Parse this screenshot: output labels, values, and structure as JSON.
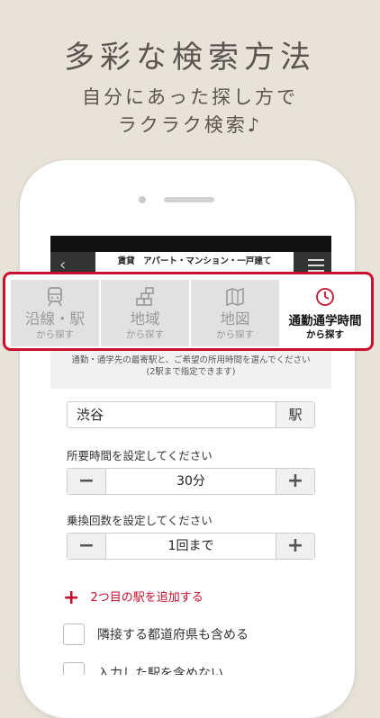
{
  "promo": {
    "headline": "多彩な検索方法",
    "sub1": "自分にあった探し方で",
    "sub2": "ラクラク検索♪"
  },
  "header": {
    "title": "賃貸　アパート・マンション・一戸建て"
  },
  "tabs": [
    {
      "label": "沿線・駅",
      "sub": "から探す",
      "icon": "train-icon"
    },
    {
      "label": "地域",
      "sub": "から探す",
      "icon": "region-icon"
    },
    {
      "label": "地図",
      "sub": "から探す",
      "icon": "map-icon"
    },
    {
      "label": "通勤通学時間",
      "sub": "から探す",
      "icon": "clock-icon",
      "active": true
    }
  ],
  "form": {
    "instruction1": "通勤・通学先の最寄駅と、ご希望の所用時間を選んでください",
    "instruction2": "(2駅まで指定できます)",
    "station_value": "渋谷",
    "station_suffix": "駅",
    "time_label": "所要時間を設定してください",
    "time_value": "30分",
    "transfer_label": "乗換回数を設定してください",
    "transfer_value": "1回まで",
    "add_station": "2つ目の駅を追加する",
    "check_adjacent": "隣接する都道府県も含める",
    "check_exclude": "入力した駅を含めない"
  },
  "colors": {
    "accent": "#c8102e",
    "background": "#e8e3d9"
  }
}
